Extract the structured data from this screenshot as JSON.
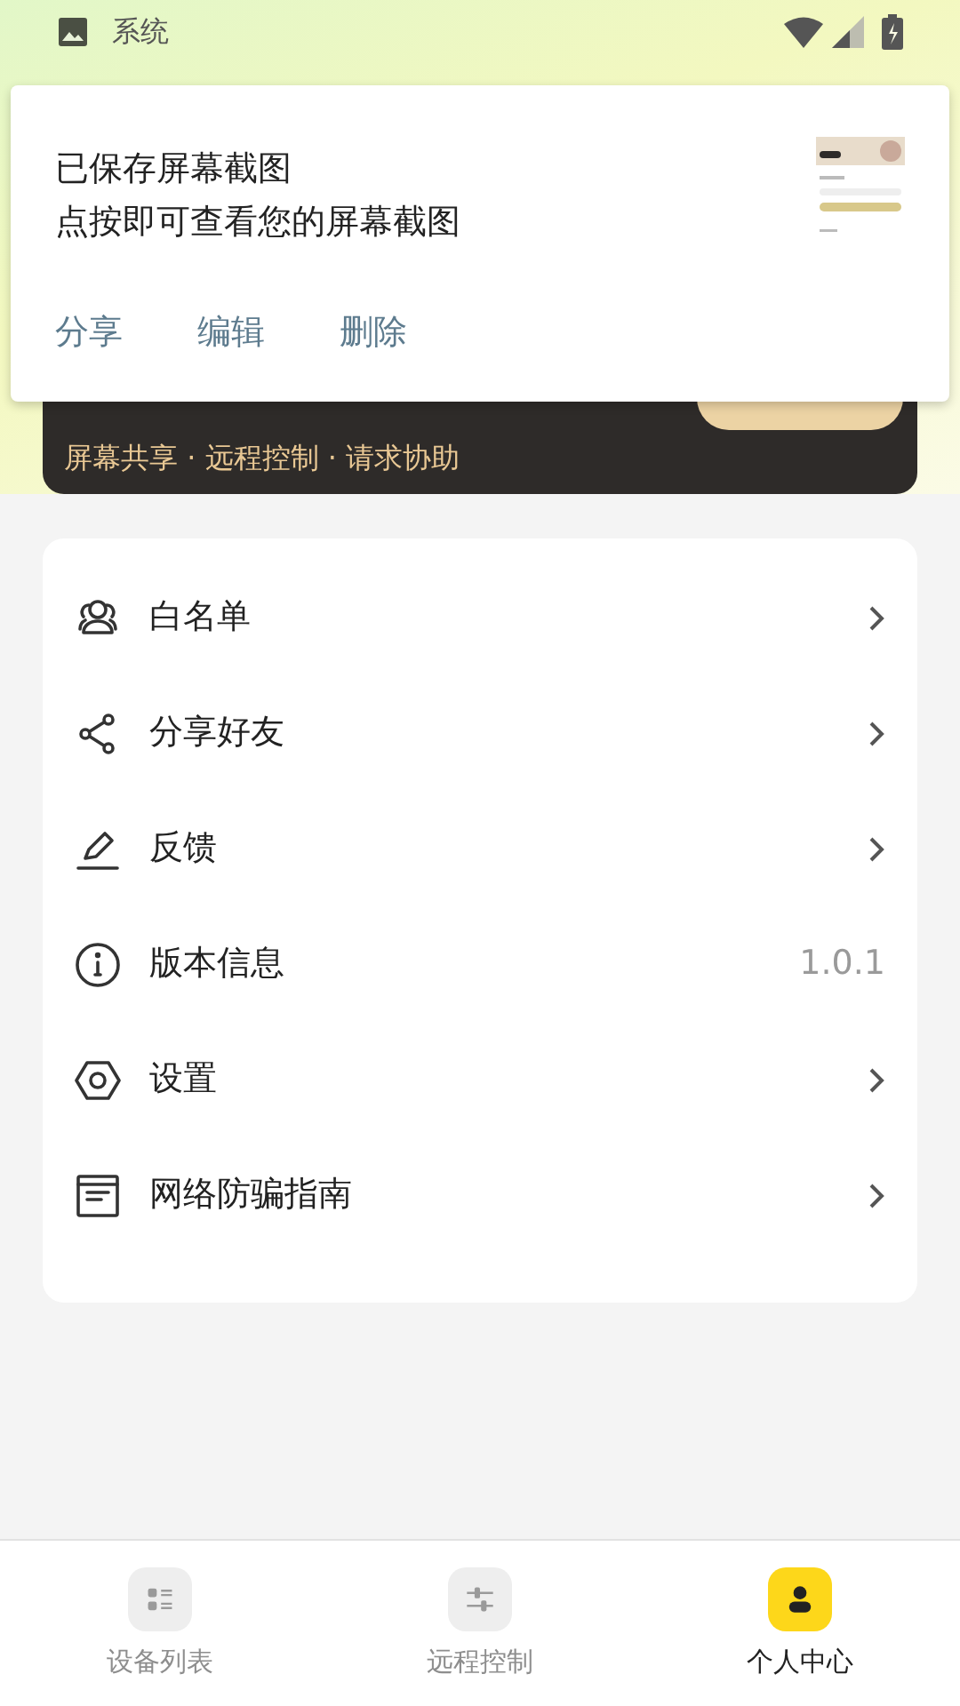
{
  "status_bar": {
    "app": "系统"
  },
  "notification": {
    "title": "已保存屏幕截图",
    "body": "点按即可查看您的屏幕截图",
    "actions": [
      "分享",
      "编辑",
      "删除"
    ]
  },
  "banner": {
    "features": "屏幕共享 · 远程控制 · 请求协助"
  },
  "menu": [
    {
      "label": "白名单",
      "kind": "link"
    },
    {
      "label": "分享好友",
      "kind": "link"
    },
    {
      "label": "反馈",
      "kind": "link"
    },
    {
      "label": "版本信息",
      "kind": "value",
      "value": "1.0.1"
    },
    {
      "label": "设置",
      "kind": "link"
    },
    {
      "label": "网络防骗指南",
      "kind": "link"
    }
  ],
  "tabs": [
    {
      "label": "设备列表",
      "selected": false
    },
    {
      "label": "远程控制",
      "selected": false
    },
    {
      "label": "个人中心",
      "selected": true
    }
  ]
}
